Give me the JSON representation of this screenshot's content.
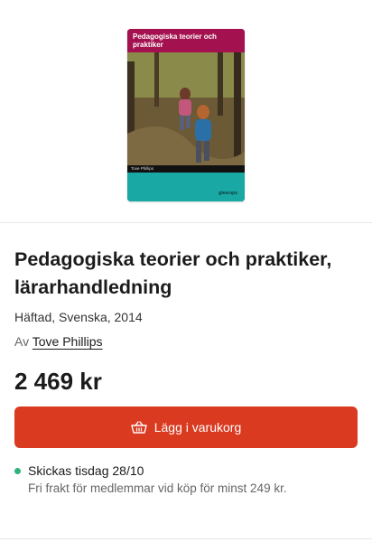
{
  "product": {
    "cover": {
      "title": "Pedagogiska teorier och praktiker",
      "author": "Tove Phillips",
      "publisher": "gleerups",
      "colors": {
        "top_band": "#a3124f",
        "bottom_band": "#1aa8a4"
      }
    },
    "title": "Pedagogiska teorier och praktiker, lärarhandledning",
    "format_line": "Häftad, Svenska, 2014",
    "author_prefix": "Av",
    "author_name": "Tove Phillips",
    "price": "2 469 kr",
    "add_to_cart_label": "Lägg i varukorg",
    "add_to_cart_icon": "basket-icon",
    "accent_color": "#d93a20",
    "shipping": {
      "status_color": "#2eb37a",
      "delivery": "Skickas tisdag 28/10",
      "free_shipping": "Fri frakt för medlemmar vid köp för minst 249 kr."
    }
  }
}
